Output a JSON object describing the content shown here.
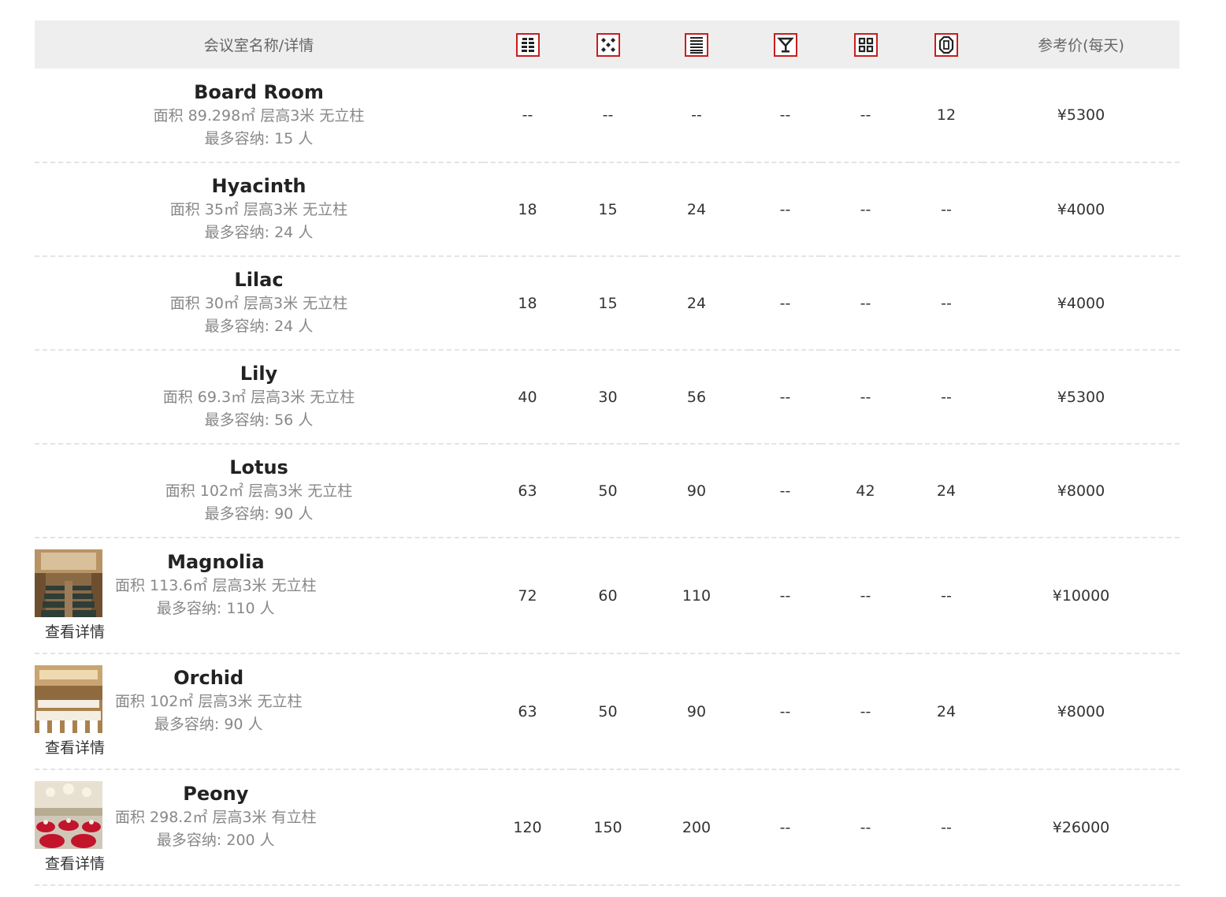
{
  "header": {
    "name_col": "会议室名称/详情",
    "price_col": "参考价(每天)",
    "layout_icons": [
      "theater-layout-icon",
      "banquet-layout-icon",
      "classroom-layout-icon",
      "cocktail-layout-icon",
      "island-layout-icon",
      "boardroom-layout-icon"
    ]
  },
  "rooms": [
    {
      "name": "Board Room",
      "area": "面积 89.298㎡ 层高3米 无立柱",
      "capacity": "最多容纳: 15 人",
      "values": [
        "--",
        "--",
        "--",
        "--",
        "--",
        "12"
      ],
      "price": "¥5300"
    },
    {
      "name": "Hyacinth",
      "area": "面积 35㎡ 层高3米 无立柱",
      "capacity": "最多容纳: 24 人",
      "values": [
        "18",
        "15",
        "24",
        "--",
        "--",
        "--"
      ],
      "price": "¥4000"
    },
    {
      "name": "Lilac",
      "area": "面积 30㎡ 层高3米 无立柱",
      "capacity": "最多容纳: 24 人",
      "values": [
        "18",
        "15",
        "24",
        "--",
        "--",
        "--"
      ],
      "price": "¥4000"
    },
    {
      "name": "Lily",
      "area": "面积 69.3㎡ 层高3米 无立柱",
      "capacity": "最多容纳: 56 人",
      "values": [
        "40",
        "30",
        "56",
        "--",
        "--",
        "--"
      ],
      "price": "¥5300"
    },
    {
      "name": "Lotus",
      "area": "面积 102㎡ 层高3米 无立柱",
      "capacity": "最多容纳: 90 人",
      "values": [
        "63",
        "50",
        "90",
        "--",
        "42",
        "24"
      ],
      "price": "¥8000"
    },
    {
      "name": "Magnolia",
      "area": "面积 113.6㎡ 层高3米 无立柱",
      "capacity": "最多容纳: 110 人",
      "values": [
        "72",
        "60",
        "110",
        "--",
        "--",
        "--"
      ],
      "price": "¥10000",
      "detail": "查看详情",
      "photo": "magnolia-room-photo"
    },
    {
      "name": "Orchid",
      "area": "面积 102㎡ 层高3米 无立柱",
      "capacity": "最多容纳: 90 人",
      "values": [
        "63",
        "50",
        "90",
        "--",
        "--",
        "24"
      ],
      "price": "¥8000",
      "detail": "查看详情",
      "photo": "orchid-room-photo"
    },
    {
      "name": "Peony",
      "area": "面积 298.2㎡ 层高3米 有立柱",
      "capacity": "最多容纳: 200 人",
      "values": [
        "120",
        "150",
        "200",
        "--",
        "--",
        "--"
      ],
      "price": "¥26000",
      "detail": "查看详情",
      "photo": "peony-room-photo"
    }
  ],
  "colors": {
    "icon_border": "#c81e1e",
    "header_bg": "#eeeeee",
    "muted_text": "#888888"
  }
}
